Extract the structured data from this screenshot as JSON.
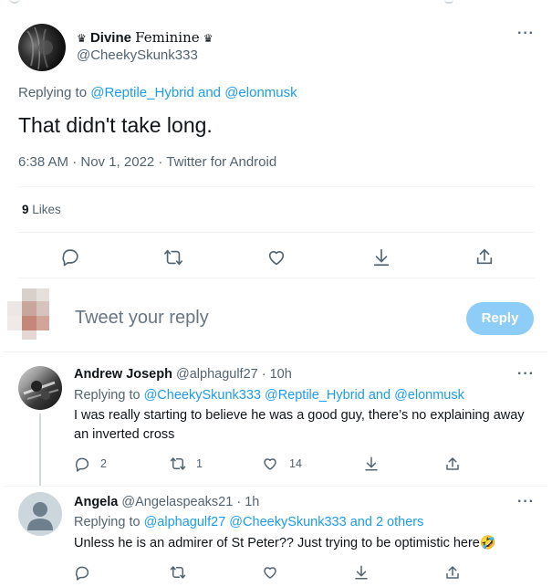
{
  "main_tweet": {
    "display_name_deco": "♛",
    "display_name_bold": "Divine",
    "display_name_rest": "Feminine",
    "handle": "@CheekySkunk333",
    "replying_prefix": "Replying to",
    "replying_to_1": "@Reptile_Hybrid",
    "replying_and": "and",
    "replying_to_2": "@elonmusk",
    "text": "That didn't take long.",
    "timestamp": "6:38 AM · Nov 1, 2022 · Twitter for Android",
    "likes_count": "9",
    "likes_label": "Likes"
  },
  "compose": {
    "placeholder": "Tweet your reply",
    "reply_button": "Reply"
  },
  "replies": [
    {
      "name": "Andrew Joseph",
      "handle": "@alphagulf27 · 10h",
      "replying_prefix": "Replying to",
      "mentions": "@CheekySkunk333 @Reptile_Hybrid",
      "and": "and",
      "last_mention": "@elonmusk",
      "text_line1": "I was really starting to believe he was a good guy, there’s no explaining away",
      "text_line2": "an inverted cross",
      "reply_count": "2",
      "retweet_count": "1",
      "like_count": "14"
    },
    {
      "name": "Angela",
      "handle": "@Angelaspeaks21 · 1h",
      "replying_prefix": "Replying to",
      "mentions": "@alphagulf27 @CheekySkunk333",
      "and": "and 2 others",
      "text": "Unless he is an admirer of St Peter?? Just trying to be optimistic here🤣"
    }
  ],
  "colors": {
    "accent": "#1d9bf0",
    "reply_button_disabled": "#8ecdf8",
    "muted_text": "#536471",
    "divider": "#eff3f4"
  },
  "icons": [
    "more-icon",
    "reply-icon",
    "retweet-icon",
    "like-icon",
    "bookmark-icon",
    "share-icon",
    "default-avatar-icon"
  ]
}
